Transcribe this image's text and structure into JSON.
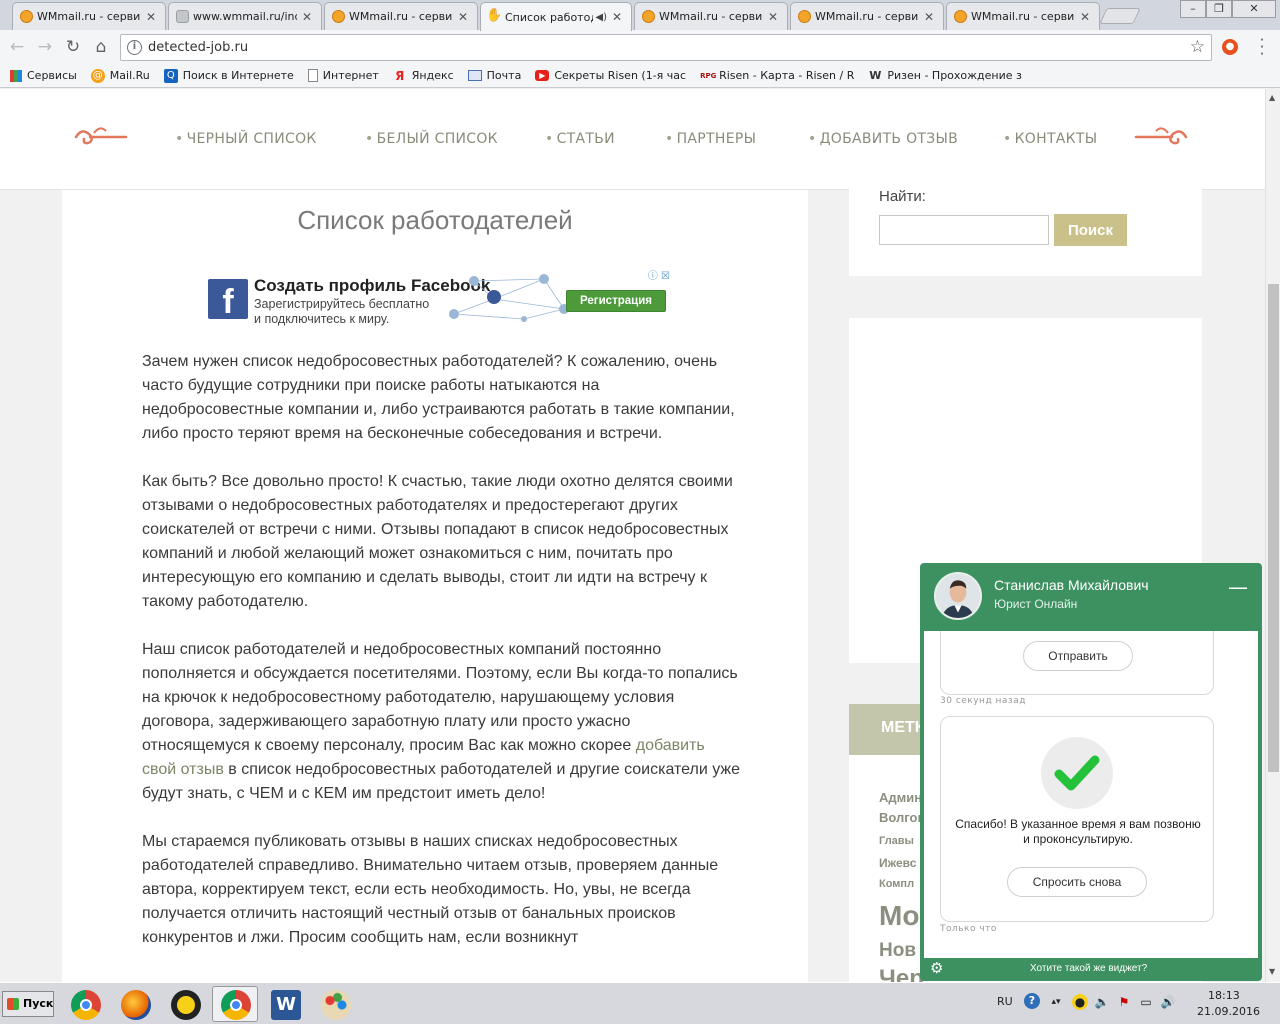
{
  "browser": {
    "tabs": [
      {
        "title": "WMmail.ru - сервис",
        "icon": "wmmail-icon"
      },
      {
        "title": "www.wmmail.ru/ind",
        "icon": "loading-icon"
      },
      {
        "title": "WMmail.ru - сервис",
        "icon": "wmmail-icon"
      },
      {
        "title": "Список работод",
        "icon": "hand-icon",
        "active": true
      },
      {
        "title": "WMmail.ru - сервис",
        "icon": "wmmail-icon"
      },
      {
        "title": "WMmail.ru - сервис",
        "icon": "wmmail-icon"
      },
      {
        "title": "WMmail.ru - сервис",
        "icon": "wmmail-icon"
      }
    ],
    "url": "detected-job.ru",
    "bookmarks": [
      {
        "label": "Сервисы",
        "icon": "apps-grid-icon"
      },
      {
        "label": "Mail.Ru",
        "icon": "mailru-icon"
      },
      {
        "label": "Поиск в Интернете",
        "icon": "search-icon"
      },
      {
        "label": "Интернет",
        "icon": "page-icon"
      },
      {
        "label": "Яндекс",
        "icon": "yandex-icon"
      },
      {
        "label": "Почта",
        "icon": "mail-icon"
      },
      {
        "label": "Секреты Risen (1-я час",
        "icon": "youtube-icon"
      },
      {
        "label": "Risen - Карта - Risen / R",
        "icon": "rpg-icon"
      },
      {
        "label": "Ризен - Прохождение з",
        "icon": "w-icon"
      }
    ]
  },
  "site": {
    "nav": [
      "ЧЕРНЫЙ СПИСОК",
      "БЕЛЫЙ СПИСОК",
      "СТАТЬИ",
      "ПАРТНЕРЫ",
      "ДОБАВИТЬ ОТЗЫВ",
      "КОНТАКТЫ"
    ],
    "page_title": "Список работодателей",
    "ad": {
      "logo": "f",
      "headline": "Создать профиль Facebook",
      "line1": "Зарегистрируйтесь бесплатно",
      "line2": "и подключитесь к миру.",
      "button": "Регистрация",
      "ad_choices": "ⓘ ☒"
    },
    "article": {
      "p1": "Зачем нужен список недобросовестных работодателей? К сожалению, очень часто будущие сотрудники при поиске работы натыкаются на недобросовестные компании и, либо устраиваются работать в такие компании, либо просто теряют время на бесконечные собеседования и встречи.",
      "p2": "Как быть? Все довольно просто! К счастью, такие люди охотно делятся своими отзывами о недобросовестных работодателях и предостерегают других соискателей от встречи с ними. Отзывы попадают в список недобросовестных компаний и любой желающий может ознакомиться с ним, почитать про интересующую его компанию и сделать выводы, стоит ли идти на встречу к такому работодателю.",
      "p3_before": "Наш список работодателей и недобросовестных компаний постоянно пополняется и обсуждается посетителями. Поэтому, если Вы когда-то попались на крючок к недобросовестному работодателю, нарушающему условия договора, задерживающего заработную плату или просто ужасно относящемуся к своему персоналу, просим Вас как можно скорее ",
      "p3_link": "добавить свой отзыв",
      "p3_after": " в список недобросовестных работодателей и другие соискатели уже будут знать, с ЧЕМ и с КЕМ им предстоит иметь дело!",
      "p4": "Мы стараемся публиковать отзывы в наших списках недобросовестных работодателей справедливо. Внимательно читаем отзыв, проверяем данные автора, корректируем текст, если есть необходимость. Но, увы, не всегда получается отличить настоящий честный отзыв от банальных происков конкурентов и лжи. Просим сообщить нам, если возникнут"
    },
    "search": {
      "label": "Найти:",
      "value": "",
      "button": "Поиск"
    },
    "tags_header": "МЕТК",
    "tags": [
      "Админ",
      "Волгог",
      "Главы",
      "Ижевс",
      "Компл",
      "Мо",
      "Нов",
      "Чер"
    ]
  },
  "chat": {
    "agent_name": "Станислав Михайлович",
    "agent_role": "Юрист Онлайн",
    "send_button": "Отправить",
    "time1": "30 секунд назад",
    "thanks": "Спасибо! В указанное время я вам позвоню и проконсультирую.",
    "ask_again": "Спросить снова",
    "time2": "Только что",
    "footer": "Хотите такой же виджет?"
  },
  "taskbar": {
    "start": "Пуск",
    "lang": "RU",
    "time": "18:13",
    "date": "21.09.2016"
  }
}
